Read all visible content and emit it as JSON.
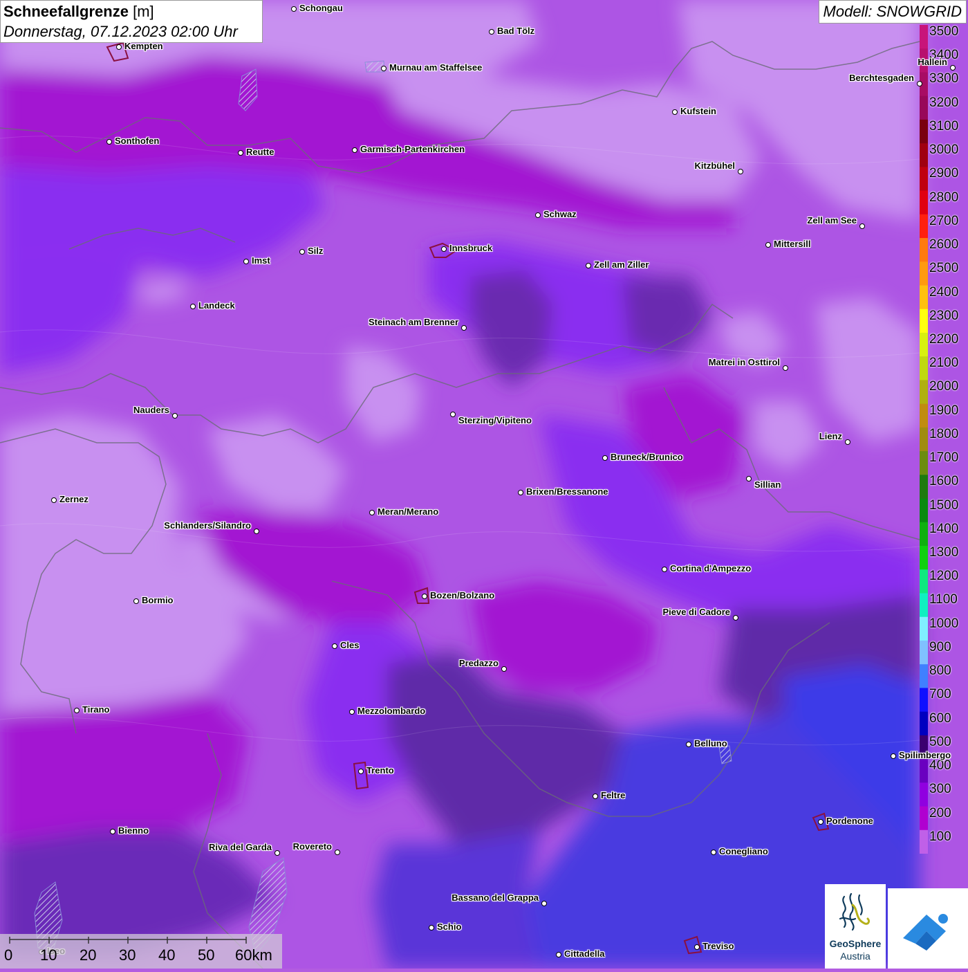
{
  "header": {
    "title_bold": "Schneefallgrenze",
    "title_unit": "[m]",
    "datetime": "Donnerstag, 07.12.2023 02:00 Uhr",
    "model": "Modell: SNOWGRID"
  },
  "legend": {
    "labels": [
      "3500",
      "3400",
      "3300",
      "3200",
      "3100",
      "3000",
      "2900",
      "2800",
      "2700",
      "2600",
      "2500",
      "2400",
      "2300",
      "2200",
      "2100",
      "2000",
      "1900",
      "1800",
      "1700",
      "1600",
      "1500",
      "1400",
      "1300",
      "1200",
      "1100",
      "1000",
      "900",
      "800",
      "700",
      "600",
      "500",
      "400",
      "300",
      "200",
      "100"
    ],
    "colors": [
      "#c8147a",
      "#b8106e",
      "#a80c64",
      "#98085a",
      "#7a0010",
      "#a00010",
      "#c00010",
      "#e00010",
      "#ff2010",
      "#ff7a10",
      "#ff9a10",
      "#ffc010",
      "#ffff10",
      "#d8f010",
      "#c0d810",
      "#b0b010",
      "#c08c10",
      "#a08c10",
      "#6c8c10",
      "#1e7a10",
      "#0a8a10",
      "#10b010",
      "#10d010",
      "#10e880",
      "#10f0c0",
      "#80f0ff",
      "#80c0ff",
      "#4080ff",
      "#1010ff",
      "#0000c0",
      "#3a0070",
      "#6a00c0",
      "#9000e0",
      "#b000d0",
      "#c060e8"
    ]
  },
  "cities": [
    {
      "name": "Schongau"
    },
    {
      "name": "Bad Tölz"
    },
    {
      "name": "Kempten"
    },
    {
      "name": "Murnau am Staffelsee"
    },
    {
      "name": "Kufstein"
    },
    {
      "name": "Berchtesgaden"
    },
    {
      "name": "Hallein"
    },
    {
      "name": "Sonthofen"
    },
    {
      "name": "Reutte"
    },
    {
      "name": "Garmisch-Partenkirchen"
    },
    {
      "name": "Kitzbühel"
    },
    {
      "name": "Schwaz"
    },
    {
      "name": "Zell am See"
    },
    {
      "name": "Mittersill"
    },
    {
      "name": "Innsbruck"
    },
    {
      "name": "Imst"
    },
    {
      "name": "Silz"
    },
    {
      "name": "Zell am Ziller"
    },
    {
      "name": "Landeck"
    },
    {
      "name": "Steinach am Brenner"
    },
    {
      "name": "Matrei in Osttirol"
    },
    {
      "name": "Nauders"
    },
    {
      "name": "Sterzing/Vipiteno"
    },
    {
      "name": "Lienz"
    },
    {
      "name": "Bruneck/Brunico"
    },
    {
      "name": "Sillian"
    },
    {
      "name": "Zernez"
    },
    {
      "name": "Brixen/Bressanone"
    },
    {
      "name": "Meran/Merano"
    },
    {
      "name": "Schlanders/Silandro"
    },
    {
      "name": "Cortina d'Ampezzo"
    },
    {
      "name": "Bozen/Bolzano"
    },
    {
      "name": "Bormio"
    },
    {
      "name": "Pieve di Cadore"
    },
    {
      "name": "Cles"
    },
    {
      "name": "Predazzo"
    },
    {
      "name": "Tirano"
    },
    {
      "name": "Mezzolombardo"
    },
    {
      "name": "Belluno"
    },
    {
      "name": "Spilimbergo"
    },
    {
      "name": "Trento"
    },
    {
      "name": "Feltre"
    },
    {
      "name": "Pordenone"
    },
    {
      "name": "Bienno"
    },
    {
      "name": "Riva del Garda"
    },
    {
      "name": "Rovereto"
    },
    {
      "name": "Conegliano"
    },
    {
      "name": "Bassano del Grappa"
    },
    {
      "name": "Schio"
    },
    {
      "name": "Treviso"
    },
    {
      "name": "Cittadella"
    },
    {
      "name": "Iseo"
    }
  ],
  "scale": {
    "labels": [
      "0",
      "10",
      "20",
      "30",
      "40",
      "50",
      "60km"
    ]
  },
  "logos": {
    "geosphere_name": "GeoSphere",
    "geosphere_sub": "Austria"
  }
}
